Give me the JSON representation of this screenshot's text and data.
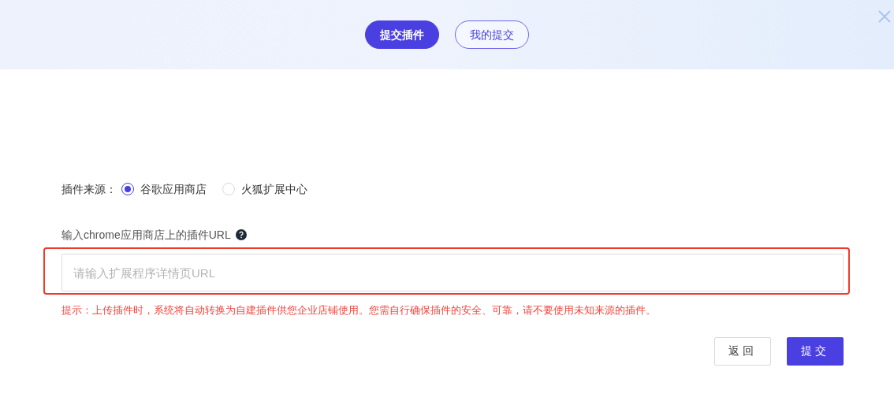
{
  "tabs": [
    {
      "label": "提交插件",
      "selected": true
    },
    {
      "label": "我的提交",
      "selected": false
    }
  ],
  "source": {
    "label": "插件来源：",
    "options": [
      {
        "label": "谷歌应用商店",
        "selected": true
      },
      {
        "label": "火狐扩展中心",
        "selected": false
      }
    ]
  },
  "url_field": {
    "label": "输入chrome应用商店上的插件URL",
    "placeholder": "请输入扩展程序详情页URL",
    "highlighted": true
  },
  "hint": "提示：上传插件时，系统将自动转换为自建插件供您企业店铺使用。您需自行确保插件的安全、可靠，请不要使用未知来源的插件。",
  "buttons": [
    {
      "label": "返回",
      "kind": "secondary"
    },
    {
      "label": "提交",
      "kind": "primary"
    }
  ]
}
